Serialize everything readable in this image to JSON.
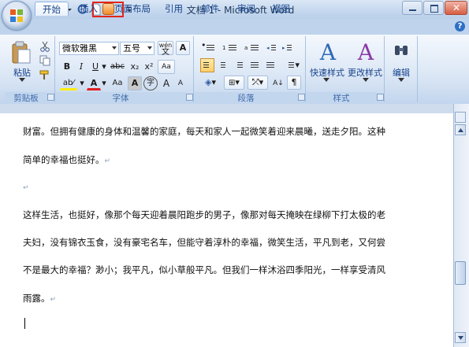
{
  "window": {
    "title": "文档 1 - Microsoft Word"
  },
  "tabs": [
    {
      "label": "开始"
    },
    {
      "label": "插入"
    },
    {
      "label": "页面布局"
    },
    {
      "label": "引用"
    },
    {
      "label": "邮件"
    },
    {
      "label": "审阅"
    },
    {
      "label": "视图"
    }
  ],
  "clipboard": {
    "paste_label": "粘贴",
    "group_label": "剪贴板"
  },
  "font": {
    "name_value": "微软雅黑",
    "size_value": "五号",
    "bold": "B",
    "italic": "I",
    "underline": "U",
    "strike": "abc",
    "subscript": "x₂",
    "superscript": "x²",
    "clear_format": "Aa",
    "font_color": "A",
    "change_case": "Aa",
    "char_shading": "A",
    "enclose_char": "字",
    "grow": "A",
    "shrink": "A",
    "phonetic": "wén",
    "char_border": "A",
    "group_label": "字体"
  },
  "paragraph": {
    "group_label": "段落"
  },
  "styles": {
    "quick_styles_label": "快速样式",
    "change_styles_label": "更改样式",
    "group_label": "样式"
  },
  "editing": {
    "label": "编辑"
  },
  "document": {
    "paragraphs": [
      "财富。但拥有健康的身体和温馨的家庭，每天和家人一起微笑着迎来晨曦，送走夕阳。这种",
      "简单的幸福也挺好。",
      "",
      "这样生活，也挺好，像那个每天迎着晨阳跑步的男子，像那对每天掩映在绿柳下打太极的老",
      "夫妇，没有锦衣玉食，没有豪宅名车，但能守着淳朴的幸福，微笑生活，平凡到老，又何尝",
      "不是最大的幸福？渺小；我平凡，似小草般平凡。但我们一样沐浴四季阳光，一样享受清风",
      "雨露。"
    ],
    "paragraph_mark": "↵"
  },
  "colors": {
    "highlight_box": "#e1251b",
    "accent_text": "#15428b",
    "ribbon_bg": "#dde8f6"
  }
}
